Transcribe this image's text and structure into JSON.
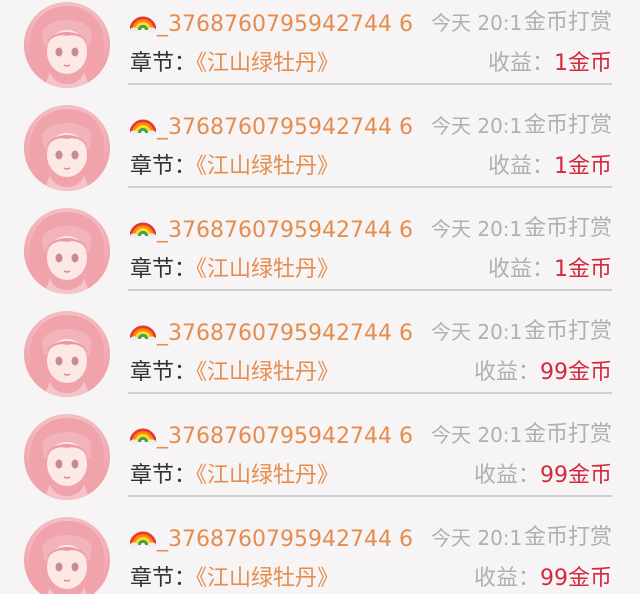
{
  "records": [
    {
      "user_prefix_icon": "rainbow-emoji",
      "username": "_3768760795942744 6",
      "time": "今天 20:1",
      "reward_type": "金币打赏",
      "chapter_label": "章节：",
      "chapter_name": "《江山绿牡丹》",
      "income_label": "收益：",
      "income_value": "1金币"
    },
    {
      "user_prefix_icon": "rainbow-emoji",
      "username": "_3768760795942744 6",
      "time": "今天 20:1",
      "reward_type": "金币打赏",
      "chapter_label": "章节：",
      "chapter_name": "《江山绿牡丹》",
      "income_label": "收益：",
      "income_value": "1金币"
    },
    {
      "user_prefix_icon": "rainbow-emoji",
      "username": "_3768760795942744 6",
      "time": "今天 20:1",
      "reward_type": "金币打赏",
      "chapter_label": "章节：",
      "chapter_name": "《江山绿牡丹》",
      "income_label": "收益：",
      "income_value": "1金币"
    },
    {
      "user_prefix_icon": "rainbow-emoji",
      "username": "_3768760795942744 6",
      "time": "今天 20:1",
      "reward_type": "金币打赏",
      "chapter_label": "章节：",
      "chapter_name": "《江山绿牡丹》",
      "income_label": "收益：",
      "income_value": "99金币"
    },
    {
      "user_prefix_icon": "rainbow-emoji",
      "username": "_3768760795942744 6",
      "time": "今天 20:1",
      "reward_type": "金币打赏",
      "chapter_label": "章节：",
      "chapter_name": "《江山绿牡丹》",
      "income_label": "收益：",
      "income_value": "99金币"
    },
    {
      "user_prefix_icon": "rainbow-emoji",
      "username": "_3768760795942744 6",
      "time": "今天 20:1",
      "reward_type": "金币打赏",
      "chapter_label": "章节：",
      "chapter_name": "《江山绿牡丹》",
      "income_label": "收益：",
      "income_value": "99金币"
    }
  ],
  "colors": {
    "username": "#e58d4f",
    "chapter_name": "#e58d4f",
    "income_amount": "#d4283b",
    "muted": "#b0b0b0",
    "text": "#333333",
    "background": "#f7f4f5"
  }
}
